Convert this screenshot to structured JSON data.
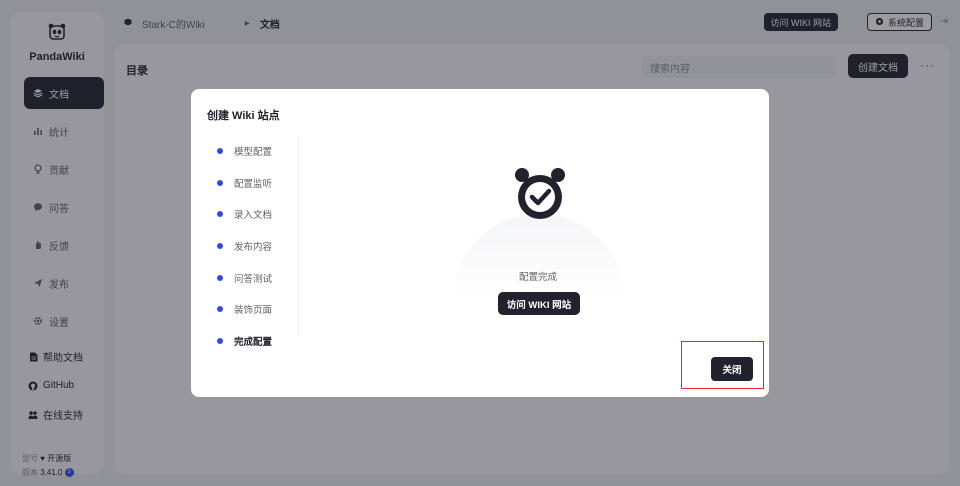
{
  "sidebar": {
    "brand": "PandaWiki",
    "nav": [
      {
        "label": "文档",
        "icon": "layers-icon",
        "active": true
      },
      {
        "label": "统计",
        "icon": "bar-chart-icon",
        "active": false
      },
      {
        "label": "贡献",
        "icon": "gift-icon",
        "active": false
      },
      {
        "label": "问答",
        "icon": "chat-icon",
        "active": false
      },
      {
        "label": "反馈",
        "icon": "hand-icon",
        "active": false
      },
      {
        "label": "发布",
        "icon": "send-icon",
        "active": false
      },
      {
        "label": "设置",
        "icon": "gear-icon",
        "active": false
      }
    ],
    "links": [
      {
        "label": "帮助文档",
        "icon": "doc-icon"
      },
      {
        "label": "GitHub",
        "icon": "github-icon"
      },
      {
        "label": "在线支持",
        "icon": "support-icon"
      }
    ],
    "edition_label": "型号",
    "edition_value": "开源版",
    "version_label": "版本",
    "version_value": "3.41.0",
    "version_badge": "5"
  },
  "topbar": {
    "wiki_name": "Stark-C的Wiki",
    "current": "文档",
    "visit_button": "访问 WIKI 网站",
    "settings_button": "系统配置"
  },
  "main": {
    "title": "目录",
    "search_placeholder": "搜索内容",
    "create_button": "创建文档",
    "more": "···"
  },
  "modal": {
    "title": "创建 Wiki 站点",
    "steps": [
      "模型配置",
      "配置监听",
      "录入文档",
      "发布内容",
      "问答测试",
      "装饰页面",
      "完成配置"
    ],
    "current_step_index": 6,
    "done_text": "配置完成",
    "visit_button": "访问 WIKI 网站",
    "close_button": "关闭"
  },
  "colors": {
    "accent": "#3248f2",
    "dark": "#21222d",
    "highlight": "#e5262f"
  }
}
